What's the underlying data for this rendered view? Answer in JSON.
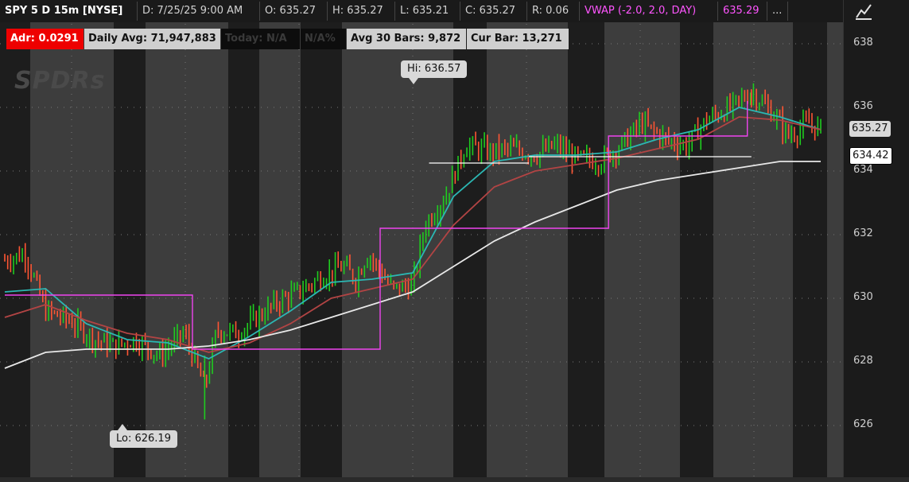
{
  "header": {
    "symbol": "SPY 5 D 15m [NYSE]",
    "date": "D: 7/25/25 9:00 AM",
    "open": "O: 635.27",
    "high": "H: 635.27",
    "low": "L: 635.21",
    "close": "C: 635.27",
    "range": "R: 0.06",
    "vwap_label": "VWAP (-2.0, 2.0, DAY)",
    "vwap_value": "635.29",
    "more": "..."
  },
  "stats": {
    "adr": "Adr: 0.0291",
    "daily_avg": "Daily Avg: 71,947,883",
    "today": "Today: N/A",
    "today_pct": "N/A%",
    "avg30": "Avg 30 Bars: 9,872",
    "cur_bar": "Cur Bar: 13,271"
  },
  "logo": "SPDRs",
  "callouts": {
    "hi": "Hi: 636.57",
    "lo": "Lo: 626.19"
  },
  "price_tags": {
    "last": "635.27",
    "ref": "634.42"
  },
  "icons": {
    "draw": "drawing-tool-icon"
  },
  "colors": {
    "up": "#1fcc1f",
    "down": "#ff5533",
    "ema_fast": "#2bb7b3",
    "ema_slow": "#b24444",
    "sma": "#e8e8e8",
    "vwap": "#ee44ee",
    "level": "#ffffff"
  },
  "chart_data": {
    "type": "candlestick",
    "symbol": "SPY",
    "interval": "15m",
    "ylim": [
      625,
      638.5
    ],
    "ytick_labels": [
      "638",
      "636",
      "634",
      "632",
      "630",
      "628",
      "626"
    ],
    "yticks": [
      638,
      636,
      634,
      632,
      630,
      628,
      626
    ],
    "grid": true,
    "high": 636.57,
    "low": 626.19,
    "last": 635.27,
    "reference_level": 634.42,
    "price_path": [
      [
        0,
        631.2
      ],
      [
        0.05,
        631.4
      ],
      [
        0.1,
        629.6
      ],
      [
        0.16,
        629.3
      ],
      [
        0.22,
        628.7
      ],
      [
        0.27,
        628.5
      ],
      [
        0.32,
        628.7
      ],
      [
        0.38,
        628.2
      ],
      [
        0.44,
        628.9
      ],
      [
        0.49,
        627.2
      ],
      [
        0.52,
        629.0
      ],
      [
        0.57,
        628.9
      ],
      [
        0.62,
        629.4
      ],
      [
        0.67,
        629.9
      ],
      [
        0.72,
        630.2
      ],
      [
        0.78,
        630.7
      ],
      [
        0.83,
        631.0
      ],
      [
        0.86,
        630.6
      ],
      [
        0.89,
        631.4
      ],
      [
        0.95,
        630.3
      ],
      [
        1.0,
        630.4
      ],
      [
        1.03,
        632.3
      ],
      [
        1.08,
        633.2
      ],
      [
        1.13,
        634.8
      ],
      [
        1.19,
        634.6
      ],
      [
        1.24,
        634.7
      ],
      [
        1.3,
        634.5
      ],
      [
        1.35,
        634.8
      ],
      [
        1.4,
        634.4
      ],
      [
        1.46,
        634.3
      ],
      [
        1.51,
        634.8
      ],
      [
        1.56,
        635.5
      ],
      [
        1.62,
        635.0
      ],
      [
        1.67,
        634.8
      ],
      [
        1.72,
        635.6
      ],
      [
        1.78,
        636.0
      ],
      [
        1.83,
        636.5
      ],
      [
        1.89,
        635.7
      ],
      [
        1.92,
        635.1
      ],
      [
        1.97,
        635.5
      ],
      [
        2.0,
        635.3
      ]
    ],
    "series": [
      {
        "name": "",
        "kind": "ema_fast",
        "values": [
          [
            0,
            630.2
          ],
          [
            0.1,
            630.3
          ],
          [
            0.2,
            629.2
          ],
          [
            0.3,
            628.7
          ],
          [
            0.4,
            628.6
          ],
          [
            0.5,
            628.1
          ],
          [
            0.6,
            628.8
          ],
          [
            0.7,
            629.6
          ],
          [
            0.8,
            630.5
          ],
          [
            0.9,
            630.6
          ],
          [
            1.0,
            630.8
          ],
          [
            1.1,
            633.2
          ],
          [
            1.2,
            634.3
          ],
          [
            1.3,
            634.5
          ],
          [
            1.4,
            634.5
          ],
          [
            1.5,
            634.6
          ],
          [
            1.6,
            635.0
          ],
          [
            1.7,
            635.3
          ],
          [
            1.8,
            636.0
          ],
          [
            1.9,
            635.7
          ],
          [
            2.0,
            635.3
          ]
        ]
      },
      {
        "name": "",
        "kind": "ema_slow",
        "values": [
          [
            0,
            629.4
          ],
          [
            0.1,
            629.8
          ],
          [
            0.2,
            629.3
          ],
          [
            0.3,
            628.9
          ],
          [
            0.4,
            628.7
          ],
          [
            0.5,
            628.3
          ],
          [
            0.6,
            628.6
          ],
          [
            0.7,
            629.2
          ],
          [
            0.8,
            630.0
          ],
          [
            0.9,
            630.3
          ],
          [
            1.0,
            630.6
          ],
          [
            1.1,
            632.3
          ],
          [
            1.2,
            633.5
          ],
          [
            1.3,
            634.0
          ],
          [
            1.4,
            634.2
          ],
          [
            1.5,
            634.4
          ],
          [
            1.6,
            634.7
          ],
          [
            1.7,
            635.0
          ],
          [
            1.8,
            635.7
          ],
          [
            1.9,
            635.6
          ],
          [
            2.0,
            635.3
          ]
        ]
      },
      {
        "name": "",
        "kind": "sma",
        "values": [
          [
            0,
            627.8
          ],
          [
            0.1,
            628.3
          ],
          [
            0.2,
            628.4
          ],
          [
            0.3,
            628.4
          ],
          [
            0.4,
            628.4
          ],
          [
            0.5,
            628.5
          ],
          [
            0.6,
            628.7
          ],
          [
            0.7,
            629.0
          ],
          [
            0.8,
            629.4
          ],
          [
            0.9,
            629.8
          ],
          [
            1.0,
            630.2
          ],
          [
            1.1,
            631.0
          ],
          [
            1.2,
            631.8
          ],
          [
            1.3,
            632.4
          ],
          [
            1.4,
            632.9
          ],
          [
            1.5,
            633.4
          ],
          [
            1.6,
            633.7
          ],
          [
            1.7,
            633.9
          ],
          [
            1.8,
            634.1
          ],
          [
            1.9,
            634.3
          ],
          [
            2.0,
            634.3
          ]
        ]
      },
      {
        "name": "",
        "kind": "vwap_steps",
        "values": [
          [
            0,
            630.1
          ],
          [
            0.46,
            630.1
          ],
          [
            0.46,
            628.4
          ],
          [
            0.92,
            628.4
          ],
          [
            0.92,
            632.2
          ],
          [
            1.48,
            632.2
          ],
          [
            1.48,
            635.1
          ],
          [
            1.82,
            635.1
          ],
          [
            1.82,
            636.2
          ]
        ]
      }
    ],
    "hlines": [
      {
        "value": 634.25,
        "x_from": 1.04,
        "x_to": 1.82
      },
      {
        "value": 634.45,
        "x_from": 1.83,
        "x_to": 2.5
      }
    ],
    "x_end": 2.5
  }
}
